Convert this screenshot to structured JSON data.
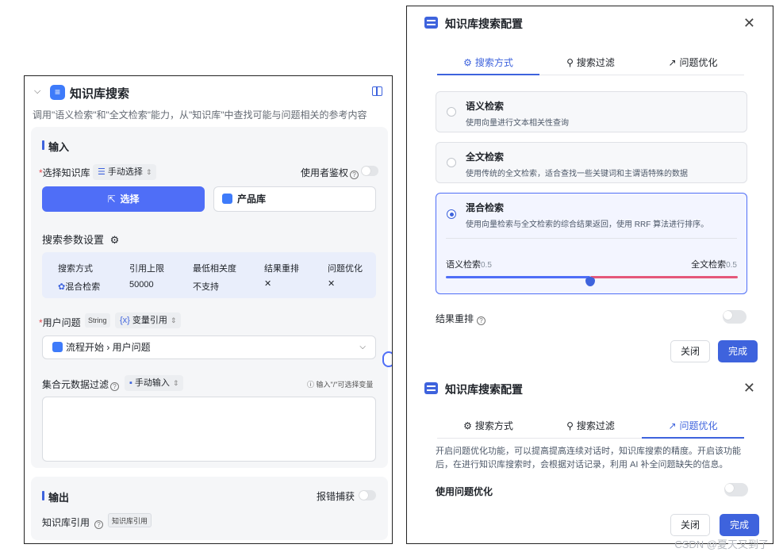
{
  "left": {
    "title": "知识库搜索",
    "description": "调用\"语义检索\"和\"全文检索\"能力，从\"知识库\"中查找可能与问题相关的参考内容",
    "input_section": {
      "title": "输入",
      "kb_label": "选择知识库",
      "kb_mode": "手动选择",
      "auth_label": "使用者鉴权",
      "select_button": "选择",
      "selected_kb": "产品库",
      "param_title": "搜索参数设置",
      "param_headers": [
        "搜索方式",
        "引用上限",
        "最低相关度",
        "结果重排",
        "问题优化"
      ],
      "param_values": {
        "method": "混合检索",
        "limit": "50000",
        "relevance": "不支持",
        "rerank": "✕",
        "optimize": "✕"
      },
      "user_q_label": "用户问题",
      "user_q_type": "String",
      "user_q_mode": "变量引用",
      "user_q_value": "流程开始 › 用户问题",
      "filter_label": "集合元数据过滤",
      "filter_mode": "手动输入",
      "filter_hint": "输入\"/\"可选择变量"
    },
    "output_section": {
      "title": "输出",
      "error_label": "报错捕获",
      "ref_label": "知识库引用",
      "ref_tag": "知识库引用"
    }
  },
  "right_top": {
    "title": "知识库搜索配置",
    "tabs": [
      "搜索方式",
      "搜索过滤",
      "问题优化"
    ],
    "active_tab": 0,
    "options": [
      {
        "title": "语义检索",
        "desc": "使用向量进行文本相关性查询"
      },
      {
        "title": "全文检索",
        "desc": "使用传统的全文检索，适合查找一些关键词和主谓语特殊的数据"
      },
      {
        "title": "混合检索",
        "desc": "使用向量检索与全文检索的综合结果返回，使用 RRF 算法进行排序。"
      }
    ],
    "selected_option": 2,
    "slider": {
      "left_label": "语义检索",
      "left_value": "0.5",
      "right_label": "全文检索",
      "right_value": "0.5",
      "position": 0.5
    },
    "rerank_label": "结果重排",
    "close_button": "关闭",
    "done_button": "完成"
  },
  "right_bottom": {
    "title": "知识库搜索配置",
    "tabs": [
      "搜索方式",
      "搜索过滤",
      "问题优化"
    ],
    "active_tab": 2,
    "paragraph": "开启问题优化功能，可以提高提高连续对话时，知识库搜索的精度。开启该功能后，在进行知识库搜索时，会根据对话记录，利用 AI 补全问题缺失的信息。",
    "toggle_label": "使用问题优化",
    "close_button": "关闭",
    "done_button": "完成"
  },
  "watermark": "CSDN @夏天又到了",
  "colors": {
    "accent": "#3e63dd",
    "primary_button": "#4f6ef7",
    "danger": "#e5484d",
    "slider_right": "#e5587a"
  },
  "icons": [
    "chevron-down-icon",
    "database-icon",
    "book-icon",
    "help-icon",
    "gear-icon",
    "cursor-icon",
    "close-icon",
    "filter-icon",
    "trend-icon",
    "info-icon"
  ]
}
